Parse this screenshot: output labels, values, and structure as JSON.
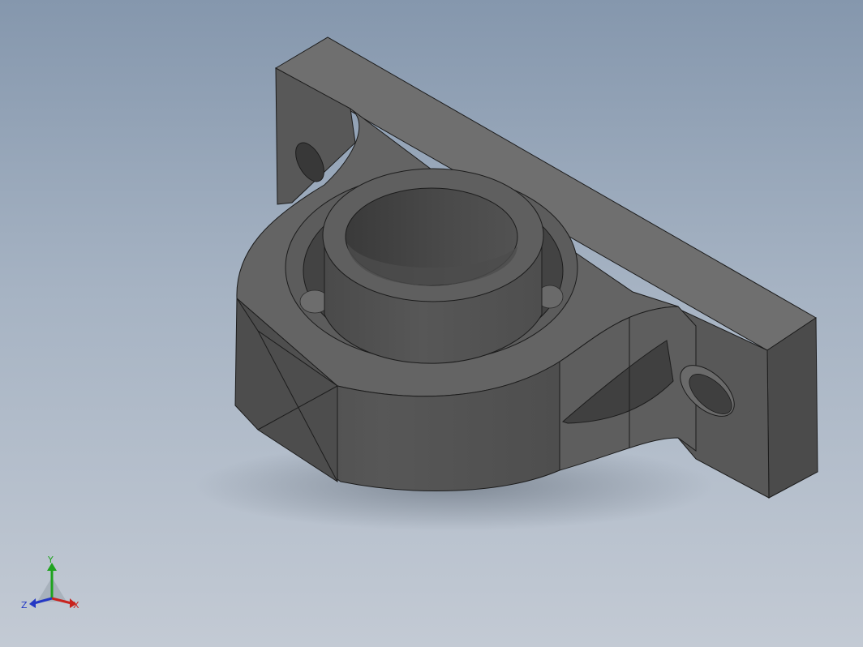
{
  "viewport": {
    "background_top": "#8597ad",
    "background_bottom": "#c3cad4"
  },
  "model": {
    "part": "pillow-block-bearing",
    "colors": {
      "dark": "#3f3f3f",
      "mid": "#5a5a5a",
      "light": "#6e6e6e",
      "top": "#707070",
      "edge": "#1c1c1c"
    }
  },
  "triad": {
    "x_label": "X",
    "y_label": "Y",
    "z_label": "Z",
    "x_color": "#c8231e",
    "y_color": "#1fa31f",
    "z_color": "#2438c4"
  }
}
